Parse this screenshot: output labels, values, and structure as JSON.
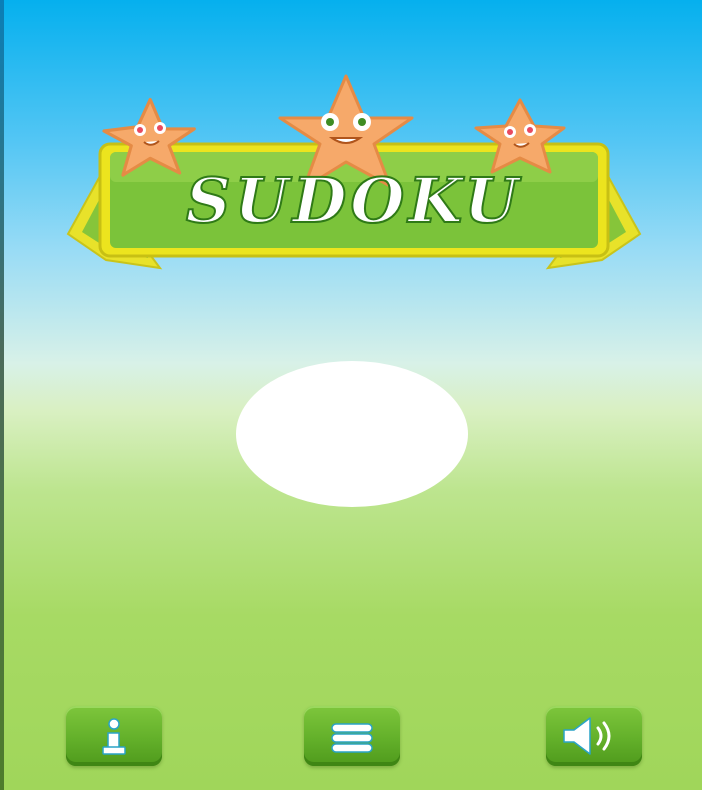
{
  "logo": {
    "title": "SUDOKU",
    "decorations": [
      "star-left",
      "star-center",
      "star-right"
    ]
  },
  "play_area": {
    "shape": "white-oval"
  },
  "buttons": {
    "info": {
      "icon": "info-icon",
      "symbol": "i"
    },
    "menu": {
      "icon": "menu-icon"
    },
    "sound": {
      "icon": "speaker-icon"
    }
  },
  "colors": {
    "sky_top": "#05b0ee",
    "grass": "#a0d65a",
    "button_green": "#63b02a",
    "star_orange": "#f6a96a",
    "title_text": "#ffffff"
  }
}
